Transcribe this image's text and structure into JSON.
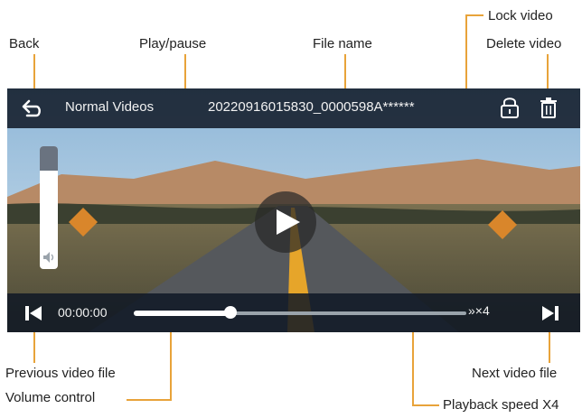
{
  "callouts": {
    "back": "Back",
    "play_pause": "Play/pause",
    "file_name": "File name",
    "lock_video": "Lock video",
    "delete_video": "Delete video",
    "previous": "Previous video file",
    "volume": "Volume control",
    "next": "Next video file",
    "speed": "Playback speed X4"
  },
  "player": {
    "title": "Normal Videos",
    "file_name": "20220916015830_0000598A******",
    "time": "00:00:00",
    "speed_label": "»×4",
    "progress": 0.29,
    "volume_level": 0.8
  },
  "colors": {
    "callout_line": "#e8a33a",
    "bar_bg": "#0f1824"
  },
  "icons": [
    "back-arrow-icon",
    "lock-icon",
    "trash-icon",
    "play-icon",
    "previous-icon",
    "next-icon",
    "speaker-icon",
    "warning-sign-icon"
  ]
}
